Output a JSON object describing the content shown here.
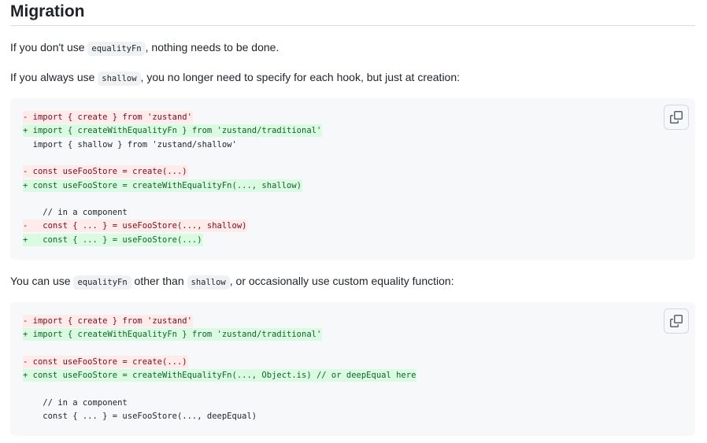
{
  "heading": "Migration",
  "para1": {
    "before": "If you don't use ",
    "code": "equalityFn",
    "after": ", nothing needs to be done."
  },
  "para2": {
    "before": "If you always use ",
    "code": "shallow",
    "after": ", you no longer need to specify for each hook, but just at creation:"
  },
  "code1": {
    "lines": [
      {
        "text": "- import { create } from 'zustand'",
        "kind": "del"
      },
      {
        "text": "+ import { createWithEqualityFn } from 'zustand/traditional'",
        "kind": "add"
      },
      {
        "text": "  import { shallow } from 'zustand/shallow'",
        "kind": "ctx"
      },
      {
        "text": "",
        "kind": "ctx"
      },
      {
        "text": "- const useFooStore = create(...)",
        "kind": "del"
      },
      {
        "text": "+ const useFooStore = createWithEqualityFn(..., shallow)",
        "kind": "add"
      },
      {
        "text": "",
        "kind": "ctx"
      },
      {
        "text": "    // in a component",
        "kind": "ctx"
      },
      {
        "text": "-   const { ... } = useFooStore(..., shallow)",
        "kind": "del"
      },
      {
        "text": "+   const { ... } = useFooStore(...)",
        "kind": "add"
      }
    ]
  },
  "para3": {
    "before": "You can use ",
    "code1": "equalityFn",
    "middle": " other than ",
    "code2": "shallow",
    "after": ", or occasionally use custom equality function:"
  },
  "code2": {
    "lines": [
      {
        "text": "- import { create } from 'zustand'",
        "kind": "del"
      },
      {
        "text": "+ import { createWithEqualityFn } from 'zustand/traditional'",
        "kind": "add"
      },
      {
        "text": "",
        "kind": "ctx"
      },
      {
        "text": "- const useFooStore = create(...)",
        "kind": "del"
      },
      {
        "text": "+ const useFooStore = createWithEqualityFn(..., Object.is) // or deepEqual here",
        "kind": "add"
      },
      {
        "text": "",
        "kind": "ctx"
      },
      {
        "text": "    // in a component",
        "kind": "ctx"
      },
      {
        "text": "    const { ... } = useFooStore(..., deepEqual)",
        "kind": "ctx"
      }
    ]
  },
  "icons": {
    "copy": "copy-icon"
  }
}
